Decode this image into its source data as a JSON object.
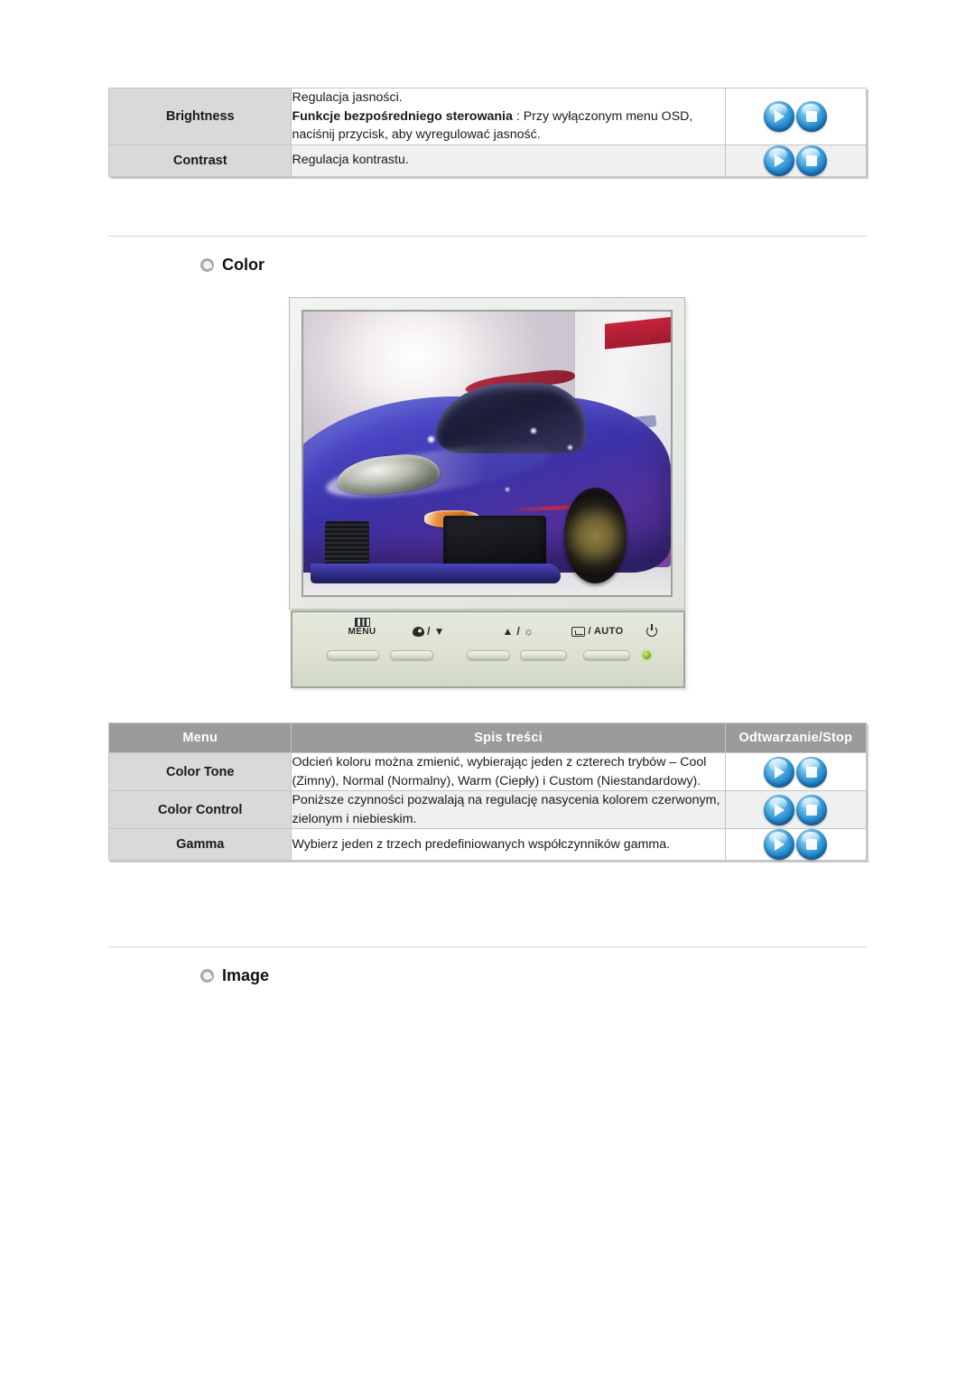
{
  "tables": {
    "top": {
      "rows": [
        {
          "menu": "Brightness",
          "desc_line1": "Regulacja jasności.",
          "desc_bold": "Funkcje bezpośredniego sterowania",
          "desc_line2": " : Przy wyłączonym menu OSD, naciśnij przycisk, aby wyregulować jasność.",
          "control": "play-stop"
        },
        {
          "menu": "Contrast",
          "desc_line1": "Regulacja kontrastu.",
          "desc_bold": "",
          "desc_line2": "",
          "control": "play-stop"
        }
      ]
    },
    "color": {
      "headers": {
        "menu": "Menu",
        "desc": "Spis treści",
        "control": "Odtwarzanie/Stop"
      },
      "rows": [
        {
          "menu": "Color Tone",
          "desc": "Odcień koloru można zmienić, wybierając jeden z czterech trybów – Cool (Zimny), Normal (Normalny), Warm (Ciepły) i Custom (Niestandardowy).",
          "control": "play-stop"
        },
        {
          "menu": "Color Control",
          "desc": "Poniższe czynności pozwalają na regulację nasycenia kolorem czerwonym, zielonym i niebieskim.",
          "control": "play-stop"
        },
        {
          "menu": "Gamma",
          "desc": "Wybierz jeden z trzech predefiniowanych współczynników gamma.",
          "control": "play-stop"
        }
      ]
    }
  },
  "sections": {
    "color_heading": "Color",
    "image_heading": "Image"
  },
  "monitor": {
    "screen_content": "blue-sports-car-photo",
    "controls": [
      {
        "id": "menu",
        "icon": "osd-menu-icon",
        "label": "MENU"
      },
      {
        "id": "down",
        "icon": "palette-icon",
        "label": "/ ▼"
      },
      {
        "id": "up",
        "icon": "up-arrow-icon",
        "label": "▲ / ☼"
      },
      {
        "id": "enter",
        "icon": "enter-icon",
        "label": "/ AUTO"
      },
      {
        "id": "power",
        "icon": "power-icon",
        "label": ""
      }
    ],
    "power_led": "on"
  },
  "colors": {
    "header_gray": "#9b9b9b",
    "menu_cell_gray": "#d9d9d9",
    "alt_row_gray": "#f0f0f0",
    "button_blue": "#2a8fd4",
    "led_green": "#8fc22a",
    "panel_green": "#dde2d2"
  }
}
